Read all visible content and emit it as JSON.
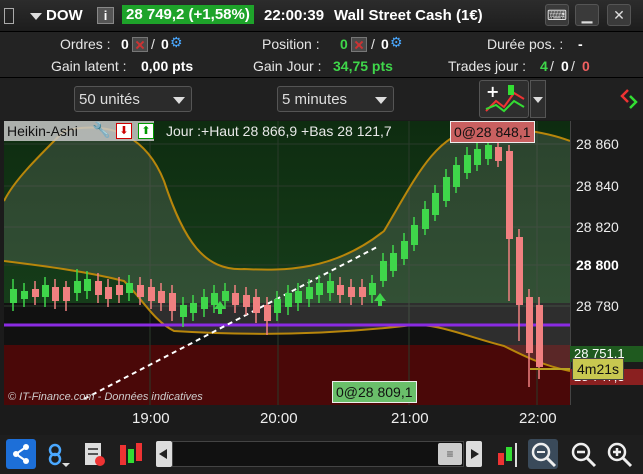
{
  "window": {
    "instrument": "DOW",
    "price_change": "28 749,2 (+1,58%)",
    "time": "22:00:39",
    "instrument_name": "Wall Street Cash (1€)"
  },
  "info": {
    "orders_label": "Ordres :",
    "orders_val1": "0",
    "orders_val2": "0",
    "position_label": "Position :",
    "position_val1": "0",
    "position_val2": "0",
    "duration_label": "Durée pos. :",
    "duration_val": "-",
    "gain_latent_label": "Gain latent :",
    "gain_latent_val": "0,00 pts",
    "gain_jour_label": "Gain Jour :",
    "gain_jour_val": "34,75 pts",
    "trades_label": "Trades jour :",
    "trades_v1": "4",
    "trades_v2": "0",
    "trades_v3": "0"
  },
  "toolbar": {
    "units": "50 unités",
    "interval": "5 minutes"
  },
  "chart": {
    "indicator_name": "Heikin-Ashi",
    "day_info": "Jour :+Haut 28 866,9 +Bas 28 121,7",
    "top_order_label": "0@28 848,1",
    "bottom_order_label": "0@28 809,1",
    "countdown": "4m21s",
    "price_tag1": "28 751,1",
    "price_tag2": "28 747,3",
    "copyright": "© IT-Finance.com - Données indicatives",
    "colors": {
      "up": "#3fd64a",
      "down": "#f08080",
      "bollinger": "#b8860b",
      "purple": "#8a2be2",
      "profit_zone": "#0f2e12",
      "loss_zone": "#4a0a0a"
    }
  },
  "chart_data": {
    "type": "candlestick",
    "y_ticks": [
      "28 860",
      "28 840",
      "28 820",
      "28 800",
      "28 780"
    ],
    "x_ticks": [
      "19:00",
      "20:00",
      "21:00",
      "22:00"
    ],
    "ylim": [
      28735,
      28872
    ]
  },
  "bottombar": {
    "icons": [
      "share-icon",
      "link-icon",
      "document-icon",
      "indicators-icon",
      "scroll-left-icon",
      "scroll-handle-icon",
      "scroll-right-icon",
      "position-icon",
      "zoom-fit-icon",
      "zoom-out-icon",
      "zoom-in-icon"
    ]
  }
}
